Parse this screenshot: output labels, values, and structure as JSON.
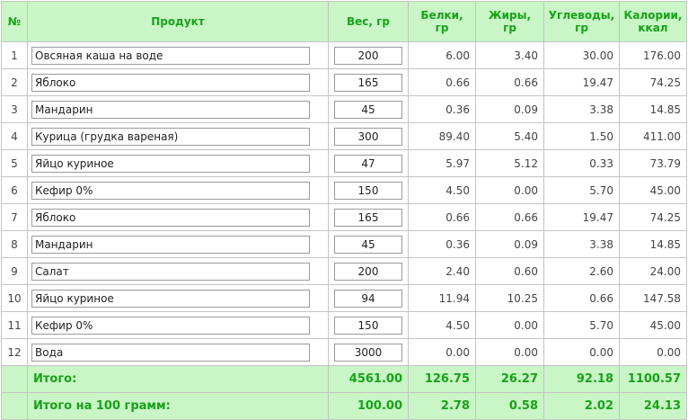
{
  "headers": {
    "num": "№",
    "product": "Продукт",
    "weight": "Вес, гр",
    "protein": [
      "Белки,",
      "гр"
    ],
    "fat": [
      "Жиры,",
      "гр"
    ],
    "carbs": [
      "Углеводы,",
      "гр"
    ],
    "calories": [
      "Калории,",
      "ккал"
    ]
  },
  "rows": [
    {
      "n": "1",
      "product": "Овсяная каша на воде",
      "weight": "200",
      "protein": "6.00",
      "fat": "3.40",
      "carbs": "30.00",
      "cal": "176.00"
    },
    {
      "n": "2",
      "product": "Яблоко",
      "weight": "165",
      "protein": "0.66",
      "fat": "0.66",
      "carbs": "19.47",
      "cal": "74.25"
    },
    {
      "n": "3",
      "product": "Мандарин",
      "weight": "45",
      "protein": "0.36",
      "fat": "0.09",
      "carbs": "3.38",
      "cal": "14.85"
    },
    {
      "n": "4",
      "product": "Курица (грудка вареная)",
      "weight": "300",
      "protein": "89.40",
      "fat": "5.40",
      "carbs": "1.50",
      "cal": "411.00"
    },
    {
      "n": "5",
      "product": "Яйцо куриное",
      "weight": "47",
      "protein": "5.97",
      "fat": "5.12",
      "carbs": "0.33",
      "cal": "73.79"
    },
    {
      "n": "6",
      "product": "Кефир 0%",
      "weight": "150",
      "protein": "4.50",
      "fat": "0.00",
      "carbs": "5.70",
      "cal": "45.00"
    },
    {
      "n": "7",
      "product": "Яблоко",
      "weight": "165",
      "protein": "0.66",
      "fat": "0.66",
      "carbs": "19.47",
      "cal": "74.25"
    },
    {
      "n": "8",
      "product": "Мандарин",
      "weight": "45",
      "protein": "0.36",
      "fat": "0.09",
      "carbs": "3.38",
      "cal": "14.85"
    },
    {
      "n": "9",
      "product": "Салат",
      "weight": "200",
      "protein": "2.40",
      "fat": "0.60",
      "carbs": "2.60",
      "cal": "24.00"
    },
    {
      "n": "10",
      "product": "Яйцо куриное",
      "weight": "94",
      "protein": "11.94",
      "fat": "10.25",
      "carbs": "0.66",
      "cal": "147.58"
    },
    {
      "n": "11",
      "product": "Кефир 0%",
      "weight": "150",
      "protein": "4.50",
      "fat": "0.00",
      "carbs": "5.70",
      "cal": "45.00"
    },
    {
      "n": "12",
      "product": "Вода",
      "weight": "3000",
      "protein": "0.00",
      "fat": "0.00",
      "carbs": "0.00",
      "cal": "0.00"
    }
  ],
  "totals": {
    "label": "Итого:",
    "weight": "4561.00",
    "protein": "126.75",
    "fat": "26.27",
    "carbs": "92.18",
    "cal": "1100.57"
  },
  "per100": {
    "label": "Итого на 100 грамм:",
    "weight": "100.00",
    "protein": "2.78",
    "fat": "0.58",
    "carbs": "2.02",
    "cal": "24.13"
  },
  "colors": {
    "header_bg": "#c9f5c7",
    "header_text": "#17a317",
    "border": "#c4c4c4"
  }
}
